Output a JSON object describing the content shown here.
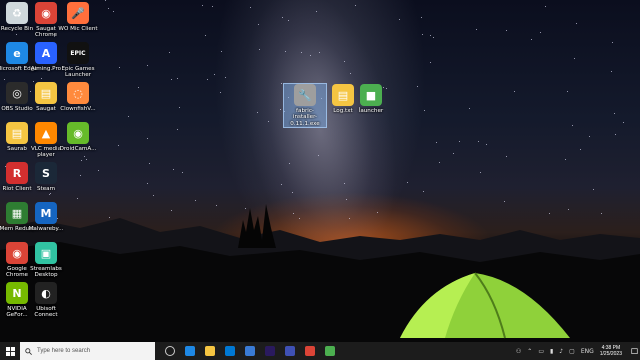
{
  "desktop": {
    "icons": [
      {
        "label": "Recycle Bin",
        "color": "#cfd8dc",
        "glyph": "♻"
      },
      {
        "label": "Saugat Chrome",
        "color": "#db4437",
        "glyph": "◉"
      },
      {
        "label": "WO Mic Client",
        "color": "#ff6f3c",
        "glyph": "🎤"
      },
      {
        "label": "Microsoft Edge",
        "color": "#1e88e5",
        "glyph": "e"
      },
      {
        "label": "Aiming.Pro",
        "color": "#2962ff",
        "glyph": "A"
      },
      {
        "label": "Epic Games Launcher",
        "color": "#111111",
        "glyph": "EPIC"
      },
      {
        "label": "OBS Studio",
        "color": "#2b2b2b",
        "glyph": "◎"
      },
      {
        "label": "Saugat",
        "color": "#f5c542",
        "glyph": "▤"
      },
      {
        "label": "ClownfishV...",
        "color": "#ff8a3d",
        "glyph": "◌"
      },
      {
        "label": "Saurab",
        "color": "#f5c542",
        "glyph": "▤"
      },
      {
        "label": "VLC media player",
        "color": "#ff8800",
        "glyph": "▲"
      },
      {
        "label": "DroidCamA...",
        "color": "#66bb2a",
        "glyph": "◉"
      },
      {
        "label": "Riot Client",
        "color": "#d32f2f",
        "glyph": "R"
      },
      {
        "label": "Steam",
        "color": "#1b2838",
        "glyph": "S"
      },
      {
        "label": "Mem Reduct",
        "color": "#2e7d32",
        "glyph": "▦"
      },
      {
        "label": "Malwareby...",
        "color": "#1565c0",
        "glyph": "M"
      },
      {
        "label": "Google Chrome",
        "color": "#db4437",
        "glyph": "◉"
      },
      {
        "label": "Streamlabs Desktop",
        "color": "#31c3a2",
        "glyph": "▣"
      },
      {
        "label": "NVIDIA GeFor...",
        "color": "#76b900",
        "glyph": "N"
      },
      {
        "label": "Ubisoft Connect",
        "color": "#222222",
        "glyph": "◐"
      }
    ],
    "center_icons": [
      {
        "label": "fabric-installer-0.11.1.exe",
        "color": "#9e9e9e",
        "glyph": "🔧",
        "selected": true
      },
      {
        "label": "Log.txt",
        "color": "#f5c542",
        "glyph": "▤",
        "selected": false
      },
      {
        "label": "launcher",
        "color": "#4caf50",
        "glyph": "■",
        "selected": false
      }
    ]
  },
  "taskbar": {
    "search_placeholder": "Type here to search",
    "apps": [
      {
        "name": "task-view",
        "color": "#cccccc"
      },
      {
        "name": "edge",
        "color": "#1e88e5"
      },
      {
        "name": "file-explorer",
        "color": "#f5c542"
      },
      {
        "name": "mail",
        "color": "#0078d4"
      },
      {
        "name": "store",
        "color": "#3a7bd5"
      },
      {
        "name": "premiere",
        "color": "#2a1a5e"
      },
      {
        "name": "app-blue",
        "color": "#3f51b5"
      },
      {
        "name": "chrome",
        "color": "#db4437"
      },
      {
        "name": "minecraft",
        "color": "#4caf50"
      }
    ],
    "tray": {
      "language": "ENG",
      "time": "4:38 PM",
      "date": "1/25/2023"
    }
  }
}
